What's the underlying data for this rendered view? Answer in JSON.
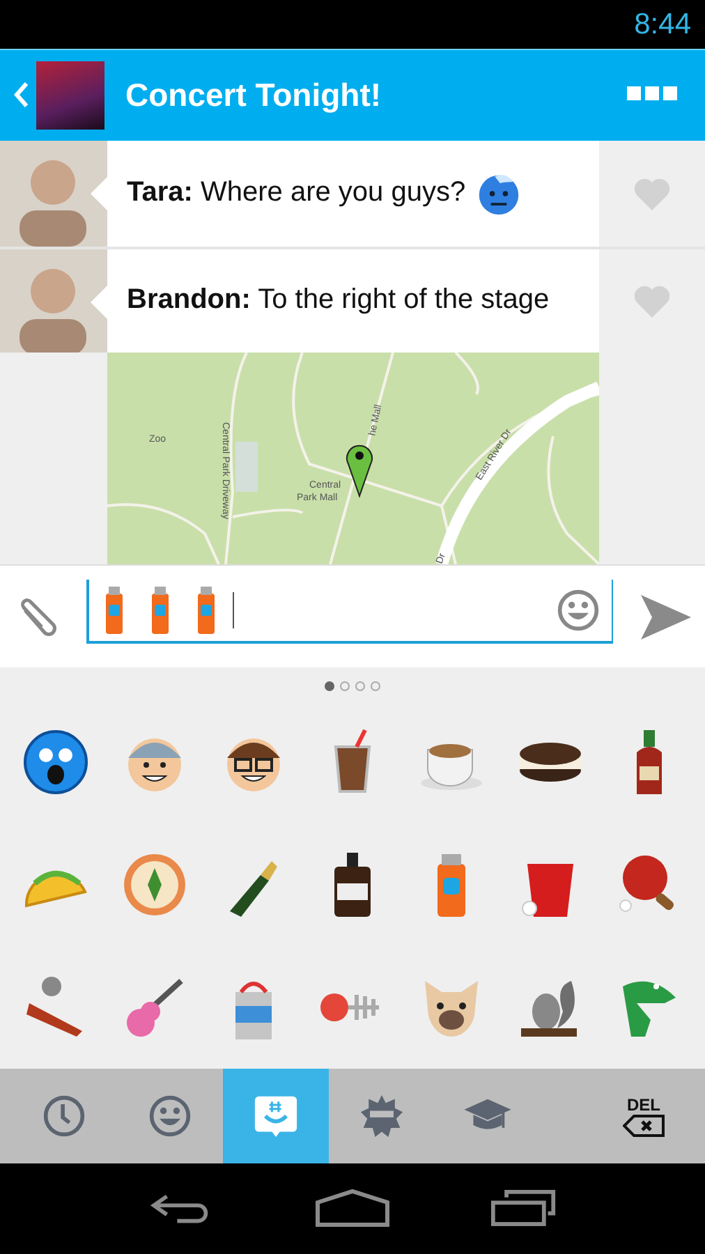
{
  "status_bar": {
    "time": "8:44"
  },
  "header": {
    "title": "Concert Tonight!"
  },
  "messages": [
    {
      "sender": "Tara:",
      "text": "Where are you guys?",
      "liked": false
    },
    {
      "sender": "Brandon:",
      "text": "To the right of the stage",
      "liked": false
    }
  ],
  "map": {
    "labels": [
      {
        "kind": "poi",
        "text": "Zoo"
      },
      {
        "kind": "road-vertical",
        "text": "Central Park Driveway"
      },
      {
        "kind": "poi2",
        "text": "Central"
      },
      {
        "kind": "poi2b",
        "text": "Park Mall"
      },
      {
        "kind": "road-diagonal",
        "text": "East River Dr"
      },
      {
        "kind": "road-mall",
        "text": "he Mall"
      },
      {
        "kind": "road-bottom",
        "text": "Dr"
      }
    ]
  },
  "pager": [
    {
      "selected": true
    },
    {
      "selected": false
    },
    {
      "selected": false
    },
    {
      "selected": false
    }
  ],
  "tabs": [
    {
      "kind": "recent",
      "selected": false
    },
    {
      "kind": "smiley",
      "selected": false
    },
    {
      "kind": "groupme",
      "selected": true
    },
    {
      "kind": "sun",
      "selected": false
    },
    {
      "kind": "grad",
      "selected": false
    },
    {
      "kind": "delete",
      "label": "DEL",
      "selected": false
    }
  ]
}
